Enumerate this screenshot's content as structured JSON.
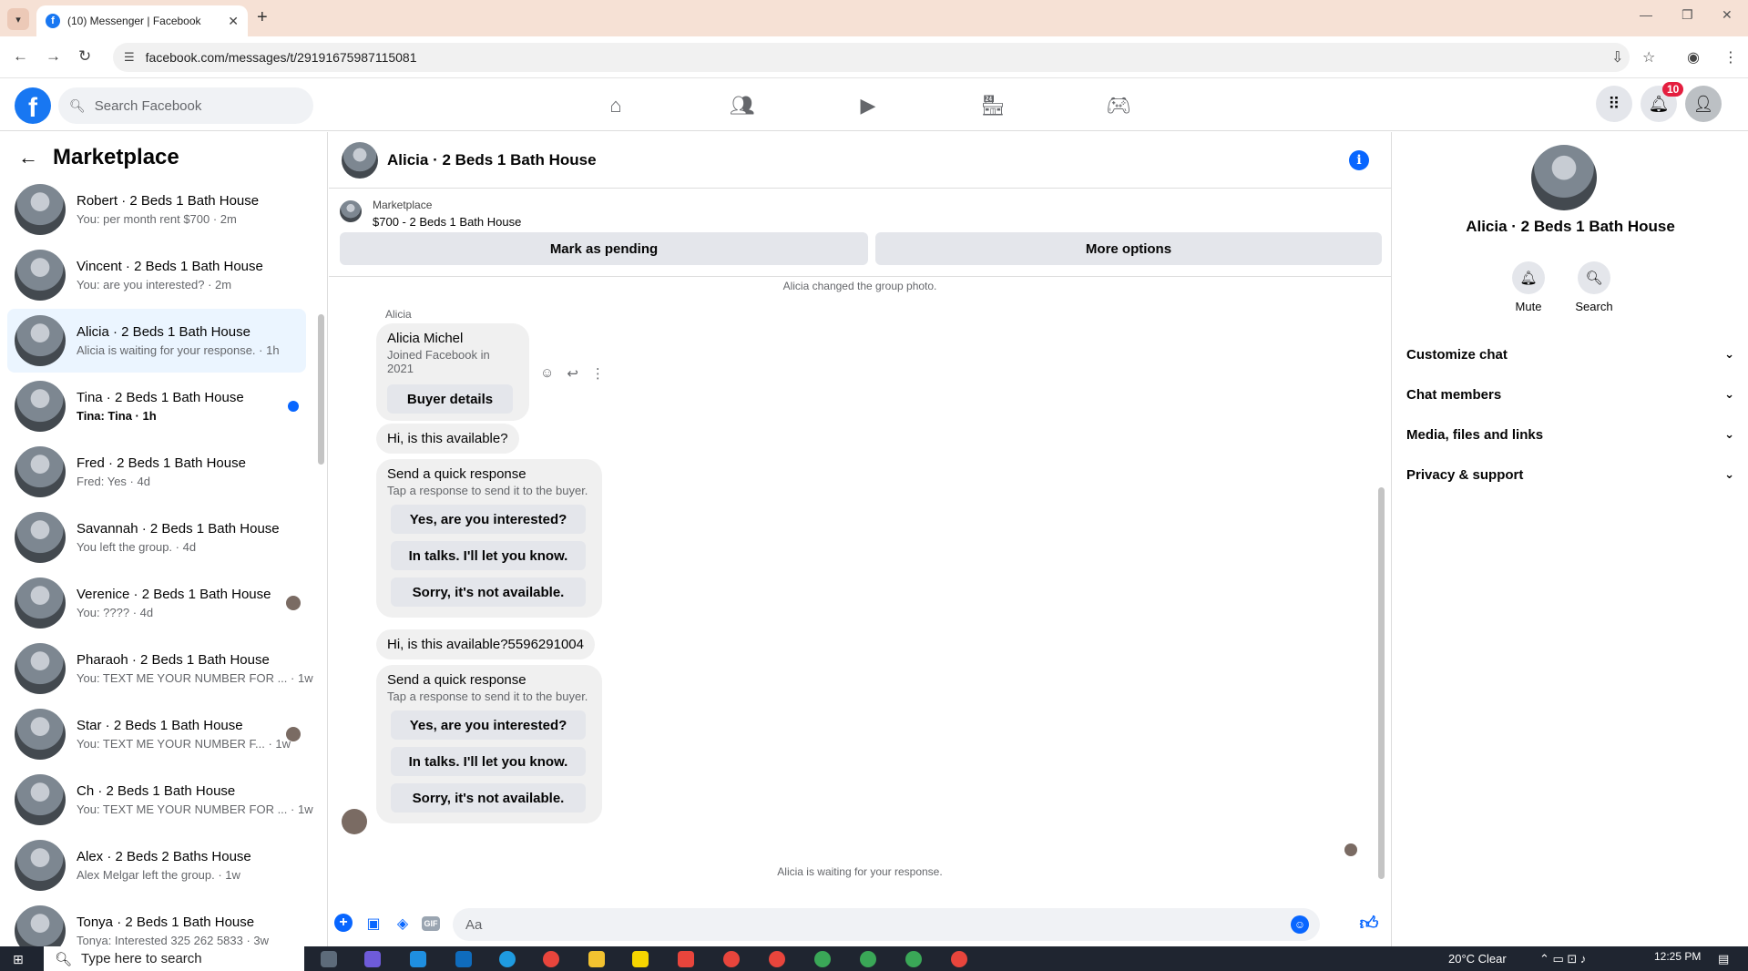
{
  "browser": {
    "tab_title": "(10) Messenger | Facebook",
    "url": "facebook.com/messages/t/29191675987115081"
  },
  "fb": {
    "search_placeholder": "Search Facebook",
    "notifications_count": "10"
  },
  "left": {
    "title": "Marketplace",
    "conversations": [
      {
        "name": "Robert · 2 Beds 1 Bath House",
        "sub": "You: per month rent $700 · 2m",
        "indicator": "none"
      },
      {
        "name": "Vincent · 2 Beds 1 Bath House",
        "sub": "You: are you interested? · 2m",
        "indicator": "none"
      },
      {
        "name": "Alicia · 2 Beds 1 Bath House",
        "sub": "Alicia is waiting for your response. · 1h",
        "indicator": "none"
      },
      {
        "name": "Tina · 2 Beds 1 Bath House",
        "sub": "Tina: Tina · 1h",
        "indicator": "unread"
      },
      {
        "name": "Fred · 2 Beds 1 Bath House",
        "sub": "Fred: Yes · 4d",
        "indicator": "none"
      },
      {
        "name": "Savannah · 2 Beds 1 Bath House",
        "sub": "You left the group. · 4d",
        "indicator": "none"
      },
      {
        "name": "Verenice · 2 Beds 1 Bath House",
        "sub": "You: ???? · 4d",
        "indicator": "seen"
      },
      {
        "name": "Pharaoh · 2 Beds 1 Bath House",
        "sub": "You: TEXT ME YOUR NUMBER FOR ... · 1w",
        "indicator": "none"
      },
      {
        "name": "Star · 2 Beds 1 Bath House",
        "sub": "You: TEXT ME YOUR NUMBER F... · 1w",
        "indicator": "seen"
      },
      {
        "name": "Ch · 2 Beds 1 Bath House",
        "sub": "You: TEXT ME YOUR NUMBER FOR ... · 1w",
        "indicator": "none"
      },
      {
        "name": "Alex · 2 Beds 2 Baths House",
        "sub": "Alex Melgar left the group. · 1w",
        "indicator": "none"
      },
      {
        "name": "Tonya · 2 Beds 1 Bath House",
        "sub": "Tonya: Interested 325 262 5833 · 3w",
        "indicator": "none"
      }
    ]
  },
  "chat": {
    "title": "Alicia · 2 Beds 1 Bath House",
    "marketplace_label": "Marketplace",
    "listing": "$700 - 2 Beds 1 Bath House",
    "mark_pending": "Mark as pending",
    "more_options": "More options",
    "system_photo": "Alicia changed the group photo.",
    "sender": "Alicia",
    "card_name": "Alicia Michel",
    "card_sub": "Joined Facebook in 2021",
    "card_button": "Buyer details",
    "msg1": "Hi, is this available?",
    "msg2": "Hi, is this available?5596291004",
    "quick_title": "Send a quick response",
    "quick_sub": "Tap a response to send it to the buyer.",
    "quick_options": [
      "Yes, are you interested?",
      "In talks. I'll let you know.",
      "Sorry, it's not available."
    ],
    "waiting": "Alicia is waiting for your response.",
    "composer_placeholder": "Aa"
  },
  "right": {
    "name": "Alicia · 2 Beds 1 Bath House",
    "mute": "Mute",
    "search": "Search",
    "rows": [
      "Customize chat",
      "Chat members",
      "Media, files and links",
      "Privacy & support"
    ]
  },
  "taskbar": {
    "search_placeholder": "Type here to search",
    "weather": "20°C  Clear",
    "time": "12:25 PM"
  },
  "colors": {
    "accent": "#0866ff",
    "tab_bar": "#f6e1d5",
    "active_conv": "#ebf5ff"
  }
}
